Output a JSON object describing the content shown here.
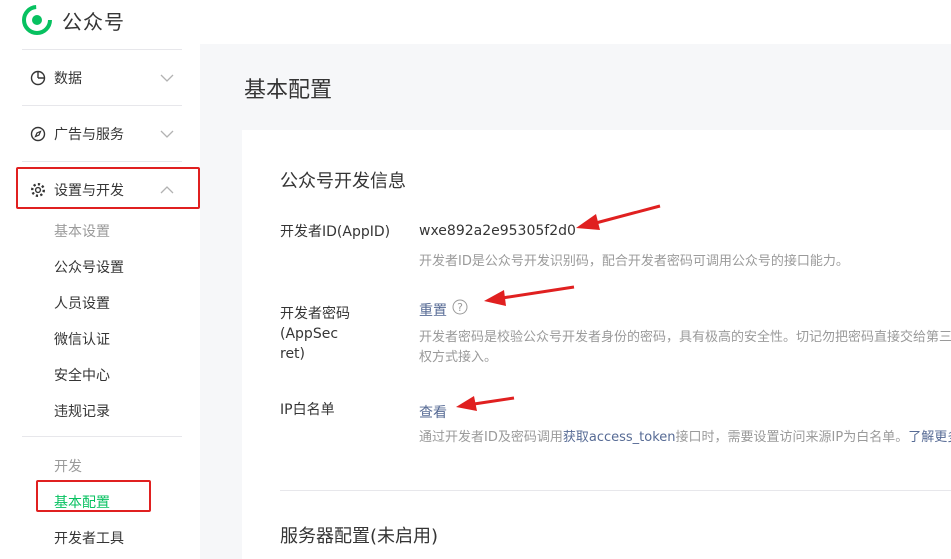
{
  "header": {
    "app_name": "公众号"
  },
  "sidebar": {
    "groups": [
      {
        "label": "数据",
        "icon": "chart-pie-icon",
        "expanded": false
      },
      {
        "label": "广告与服务",
        "icon": "compass-icon",
        "expanded": false
      },
      {
        "label": "设置与开发",
        "icon": "gear-icon",
        "expanded": true
      }
    ],
    "settings_heading": "基本设置",
    "settings_items": [
      "公众号设置",
      "人员设置",
      "微信认证",
      "安全中心",
      "违规记录"
    ],
    "dev_heading": "开发",
    "dev_items": [
      "基本配置",
      "开发者工具"
    ],
    "active_item": "基本配置"
  },
  "main": {
    "title": "基本配置",
    "dev_info": {
      "title": "公众号开发信息",
      "appid_label": "开发者ID(AppID)",
      "appid_value": "wxe892a2e95305f2d0",
      "appid_desc": "开发者ID是公众号开发识别码，配合开发者密码可调用公众号的接口能力。",
      "secret_label_1": "开发者密码(AppSec",
      "secret_label_2": "ret)",
      "secret_link": "重置",
      "secret_desc_1": "开发者密码是校验公众号开发者身份的密码，具有极高的安全性。切记勿把密码直接交给第三方",
      "secret_desc_2": "权方式接入。",
      "ip_label": "IP白名单",
      "ip_link": "查看",
      "ip_desc_prefix": "通过开发者ID及密码调用",
      "ip_desc_link": "获取access_token",
      "ip_desc_middle": "接口时，需要设置访问来源IP为白名单。",
      "ip_desc_more": "了解更多。"
    },
    "server_config": {
      "title": "服务器配置(未启用)"
    }
  },
  "colors": {
    "accent": "#07c160",
    "link": "#576b95",
    "annotation": "#e02020"
  }
}
